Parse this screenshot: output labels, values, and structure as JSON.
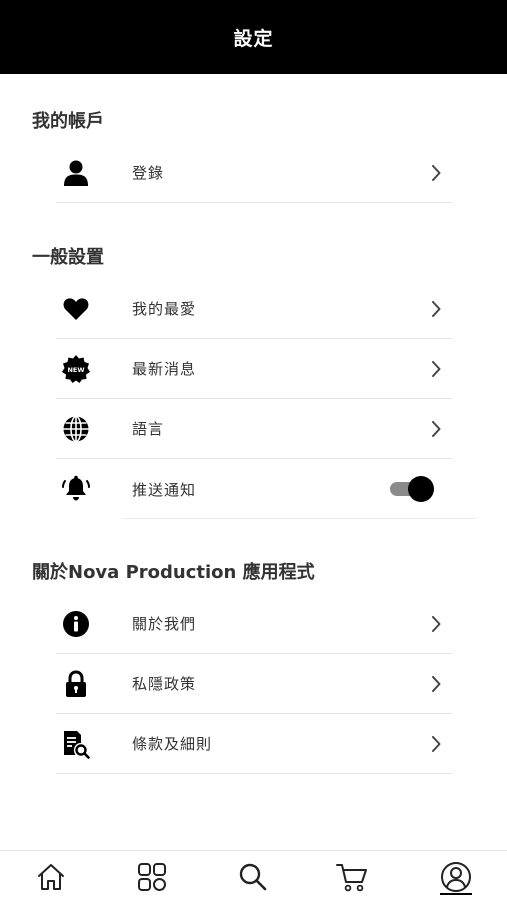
{
  "header": {
    "title": "設定"
  },
  "sections": {
    "account": {
      "title": "我的帳戶",
      "items": [
        {
          "label": "登錄",
          "icon": "user-icon"
        }
      ]
    },
    "general": {
      "title": "一般設置",
      "items": [
        {
          "label": "我的最愛",
          "icon": "heart-icon"
        },
        {
          "label": "最新消息",
          "icon": "new-badge-icon",
          "badge_text": "NEW"
        },
        {
          "label": "語言",
          "icon": "globe-icon"
        },
        {
          "label": "推送通知",
          "icon": "bell-icon",
          "toggle_on": true
        }
      ]
    },
    "about": {
      "title": "關於Nova Production 應用程式",
      "items": [
        {
          "label": "關於我們",
          "icon": "info-icon"
        },
        {
          "label": "私隱政策",
          "icon": "lock-icon"
        },
        {
          "label": "條款及細則",
          "icon": "document-search-icon"
        }
      ]
    }
  },
  "tabbar": {
    "items": [
      {
        "icon": "home-icon"
      },
      {
        "icon": "grid-icon"
      },
      {
        "icon": "search-icon"
      },
      {
        "icon": "cart-icon"
      },
      {
        "icon": "profile-icon",
        "active": true
      }
    ]
  },
  "colors": {
    "header_bg": "#000000",
    "toggle_track": "#8a8a8a",
    "toggle_knob": "#000000",
    "divider": "#e4e4e4"
  }
}
